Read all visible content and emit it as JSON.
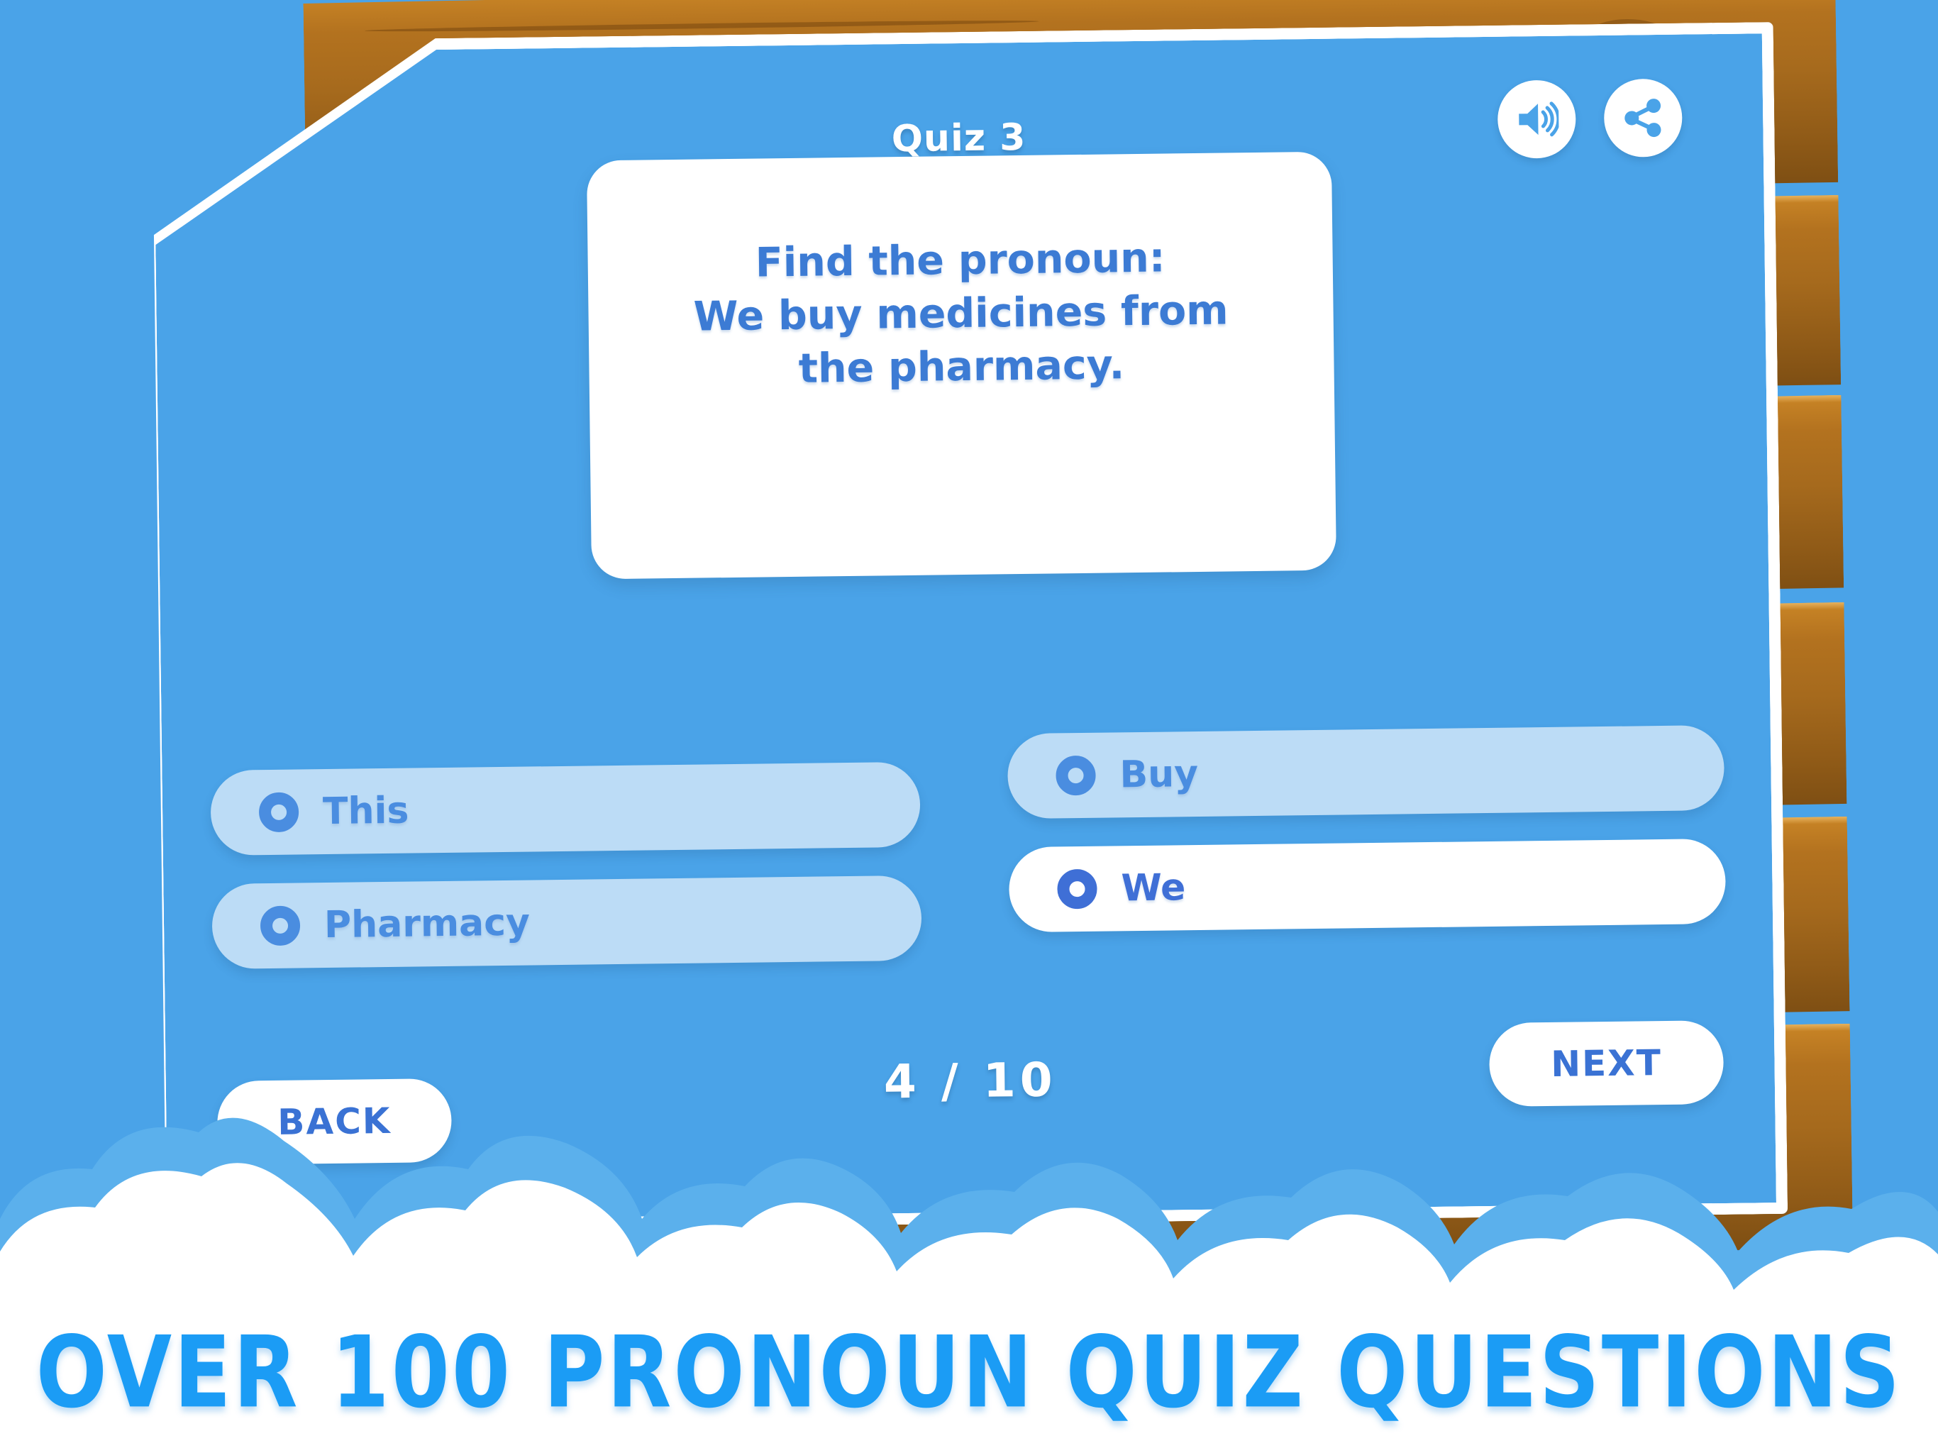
{
  "header": {
    "quiz_title": "Quiz 3",
    "sound_icon": "speaker-volume-icon",
    "share_icon": "share-icon"
  },
  "question": {
    "prompt_line1": "Find the pronoun:",
    "prompt_line2": "We buy medicines from the",
    "prompt_line3": "pharmacy.",
    "full_text": "Find the pronoun:\nWe buy medicines from the pharmacy."
  },
  "options": [
    {
      "label": "This",
      "selected": false,
      "column": "left",
      "row": 0
    },
    {
      "label": "Pharmacy",
      "selected": false,
      "column": "left",
      "row": 1
    },
    {
      "label": "Buy",
      "selected": false,
      "column": "right",
      "row": 0
    },
    {
      "label": "We",
      "selected": true,
      "column": "right",
      "row": 1
    }
  ],
  "footer": {
    "back_label": "BACK",
    "next_label": "NEXT",
    "progress": "4 / 10",
    "current_question": 4,
    "total_questions": 10
  },
  "banner": {
    "text": "OVER 100 PRONOUN QUIZ QUESTIONS"
  },
  "colors": {
    "panel_blue": "#4aa3e8",
    "sky_blue": "#4aa3e8",
    "panel_border_white": "#ffffff",
    "question_text_blue": "#3c7bd4",
    "option_bg": "#bcdcf6",
    "option_selected_bg": "#ffffff",
    "option_text": "#4a8de0",
    "option_selected_text": "#3f6fd6",
    "button_text": "#3a72d4",
    "banner_text": "#1b9cf5",
    "wood_light": "#c98526",
    "wood_dark": "#7d4e13"
  }
}
